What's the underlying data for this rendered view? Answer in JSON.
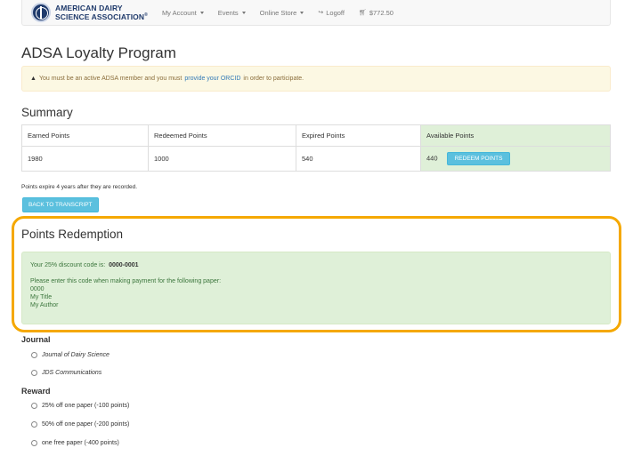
{
  "header": {
    "logo_text_line1": "AMERICAN DAIRY",
    "logo_text_line2": "SCIENCE ASSOCIATION",
    "logo_mark": "®",
    "nav": [
      {
        "label": "My Account",
        "has_caret": true
      },
      {
        "label": "Events",
        "has_caret": true
      },
      {
        "label": "Online Store",
        "has_caret": true
      },
      {
        "label": "Logoff",
        "icon": "logoff-icon"
      },
      {
        "label": "$772.50",
        "icon": "cart-icon"
      }
    ]
  },
  "page": {
    "title": "ADSA Loyalty Program"
  },
  "warning": {
    "text_before": "You must be an active ADSA member and you must",
    "link": "provide your ORCID",
    "text_after": "in order to participate."
  },
  "summary": {
    "title": "Summary",
    "columns": [
      "Earned Points",
      "Redeemed Points",
      "Expired Points",
      "Available Points"
    ],
    "values": [
      "1980",
      "1000",
      "540",
      "440"
    ],
    "redeem_button": "REDEEM POINTS",
    "note": "Points expire 4 years after they are recorded.",
    "back_button": "BACK TO TRANSCRIPT"
  },
  "redemption": {
    "title": "Points Redemption",
    "discount_label": "Your 25% discount code is:",
    "discount_code": "0000-0001",
    "instruction": "Please enter this code when making payment for the following paper:",
    "paper_lines": [
      "0000",
      "My Title",
      "My Author"
    ]
  },
  "form": {
    "journal_label": "Journal",
    "journal_options": [
      "Journal of Dairy Science",
      "JDS Communications"
    ],
    "reward_label": "Reward",
    "reward_options": [
      "25% off one paper (-100 points)",
      "50% off one paper (-200 points)",
      "one free paper (-400 points)"
    ]
  },
  "colors": {
    "highlight_outline": "#f5a800",
    "info_button": "#5bc0de",
    "success_bg": "#dff0d8",
    "warning_bg": "#fcf8e3",
    "link": "#337ab7"
  }
}
